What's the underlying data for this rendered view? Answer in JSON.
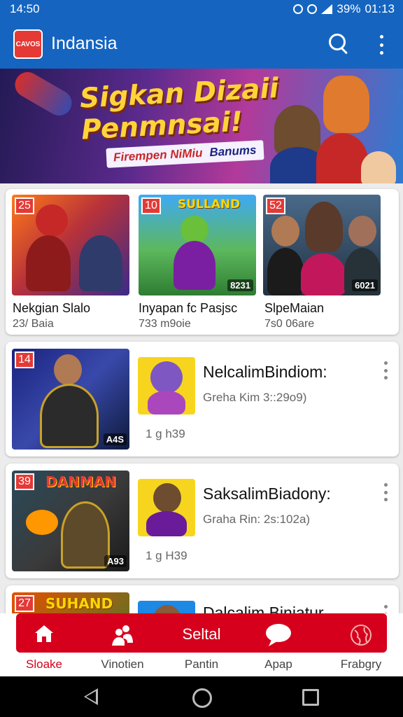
{
  "status_bar": {
    "time": "14:50",
    "battery": "39%",
    "clock": "01:13"
  },
  "app_bar": {
    "logo_text": "CAVOS",
    "title": "Indansia"
  },
  "banner": {
    "headline": "Sigkan Dizaii Penmnsai!",
    "tagline_left": "Firempen NiMiu",
    "tagline_right": "Banums"
  },
  "featured": [
    {
      "badge": "25",
      "title": "Nekgian Slalo",
      "subtitle": "23/ Baia",
      "corner": ""
    },
    {
      "badge": "10",
      "title": "Inyapan fc Pasjsc",
      "subtitle": "733 m9oie",
      "corner": "8231",
      "art_text": "SULLAND"
    },
    {
      "badge": "52",
      "title": "SlpeMaian",
      "subtitle": "7s0 06are",
      "corner": "6021"
    }
  ],
  "list": [
    {
      "badge": "14",
      "corner": "A4S",
      "title": "NelcalimBindiom:",
      "subtitle": "Greha Kim 3::29o9)",
      "meta": "1 g h39"
    },
    {
      "badge": "39",
      "corner": "A93",
      "art_text": "DANMAN",
      "title": "SaksalimBiadony:",
      "subtitle": "Graha Rin: 2s:102a)",
      "meta": "1 g H39"
    },
    {
      "badge": "27",
      "art_text": "SUHAND",
      "title": "Dalcalim Biniatur"
    }
  ],
  "bottom_nav": [
    {
      "label": "Sloake",
      "icon": "home-icon",
      "active": true
    },
    {
      "label": "Vinotien",
      "icon": "people-icon",
      "active": false
    },
    {
      "label": "Pantin",
      "icon": "text",
      "icon_text": "Seltal",
      "active": false
    },
    {
      "label": "Apap",
      "icon": "chat-bubble-icon",
      "active": false
    },
    {
      "label": "Frabgry",
      "icon": "globe-icon",
      "active": false
    }
  ],
  "colors": {
    "primary": "#1565c0",
    "accent": "#d6001c",
    "active_label": "#d6001c"
  }
}
